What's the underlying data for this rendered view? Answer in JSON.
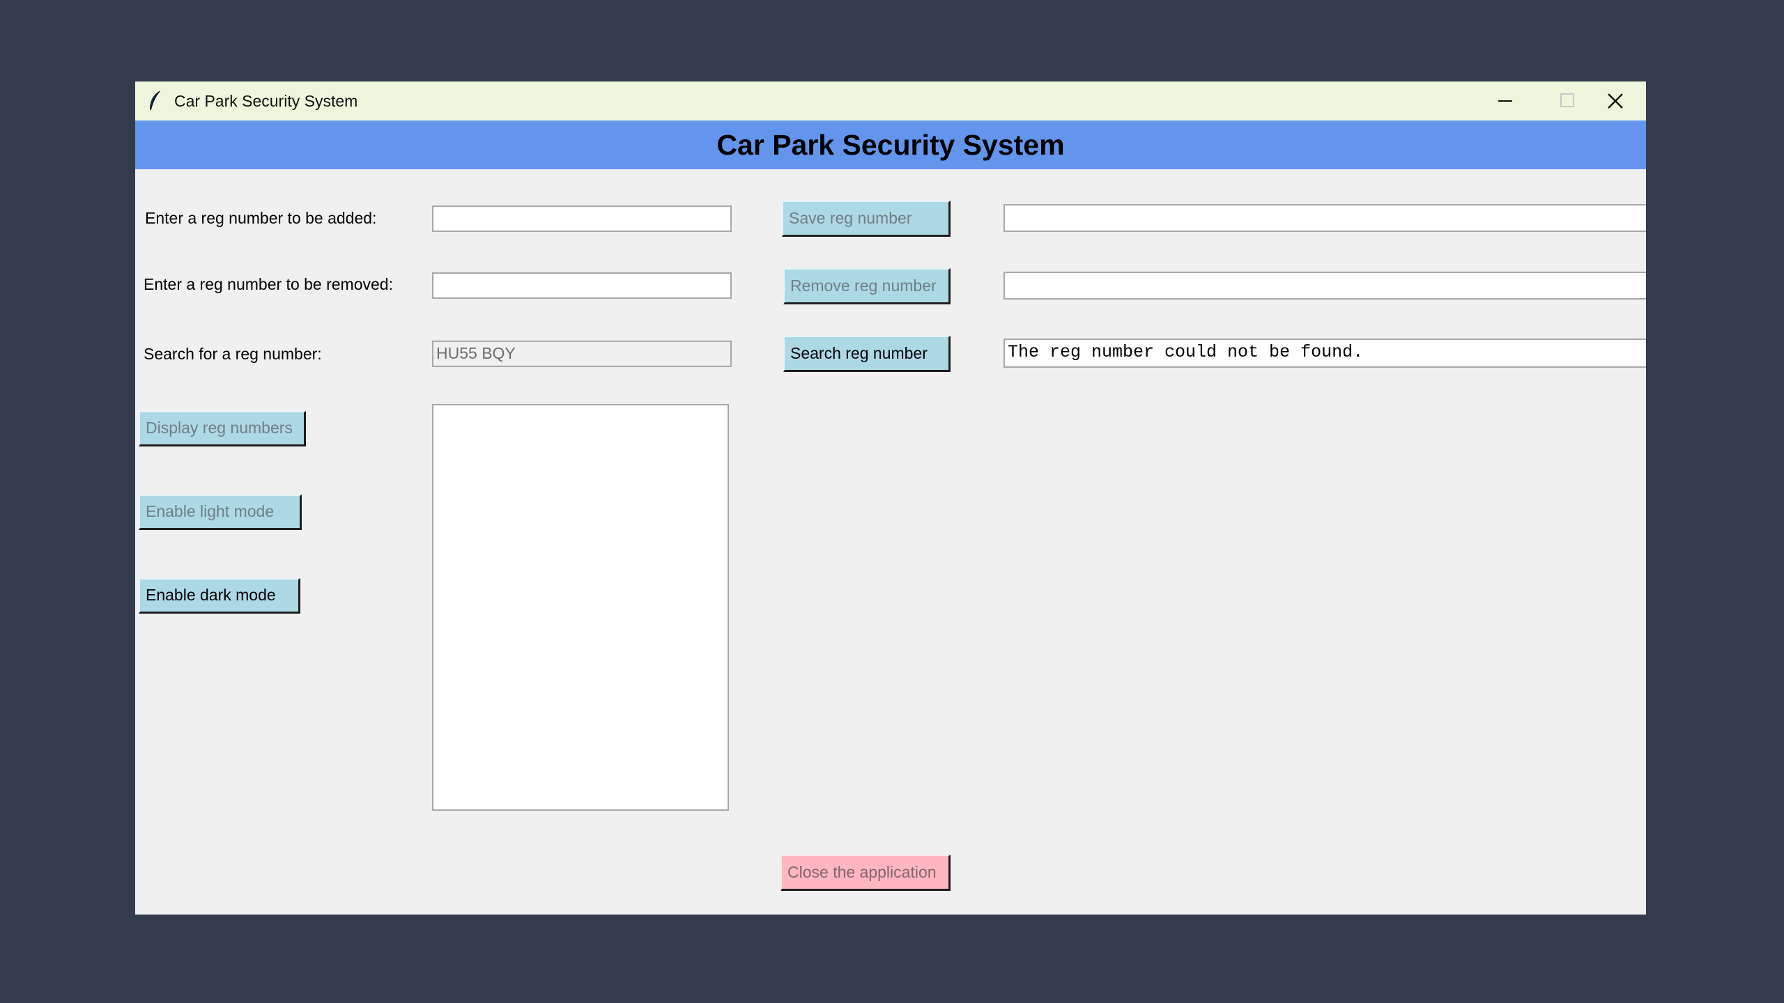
{
  "window": {
    "title": "Car Park Security System",
    "icon": "feather-icon",
    "controls": {
      "minimize": "minimize-icon",
      "maximize": "maximize-icon",
      "close": "close-icon"
    }
  },
  "header": {
    "title": "Car Park Security System",
    "color": "#6495ed"
  },
  "add": {
    "label": "Enter a reg number to be added:",
    "value": "",
    "button": "Save reg number",
    "result": ""
  },
  "remove": {
    "label": "Enter a reg number to be removed:",
    "value": "",
    "button": "Remove reg number",
    "result": ""
  },
  "search": {
    "label": "Search for a reg number:",
    "value": "HU55 BQY",
    "button": "Search reg number",
    "result": "The reg number could not be found."
  },
  "actions": {
    "display": "Display reg numbers",
    "light_mode": "Enable light mode",
    "dark_mode": "Enable dark mode",
    "close": "Close the application"
  },
  "colors": {
    "background": "#333c4d",
    "titlebar": "#eef7dd",
    "button": "#add8e6",
    "close_button": "#ffb6c1"
  }
}
